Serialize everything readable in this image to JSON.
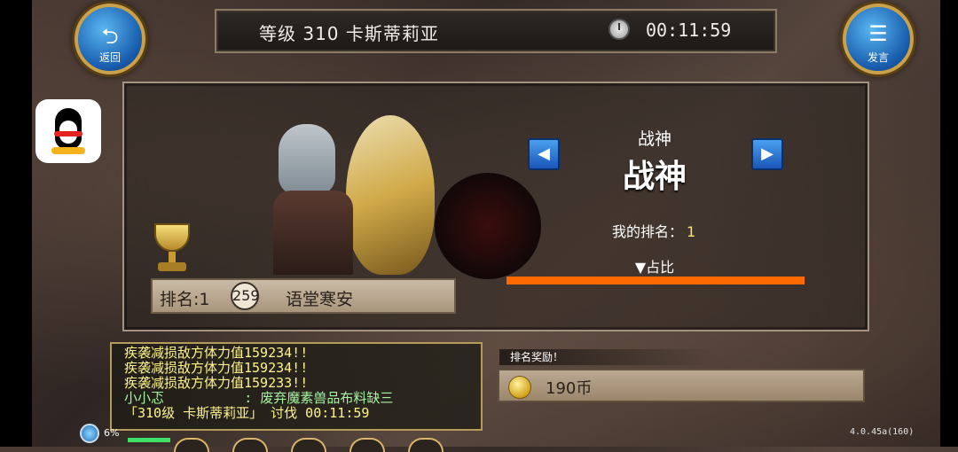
{
  "header": {
    "title": "等级 310 卡斯蒂莉亚",
    "timer": "00:11:59"
  },
  "buttons": {
    "back_label": "返回",
    "chat_label": "发言"
  },
  "panel": {
    "category_small": "战神",
    "category_big": "战神",
    "my_rank_label": "我的排名：",
    "my_rank_value": "1",
    "share_label": "▼占比",
    "player_rank": "排名:1",
    "player_level": "259",
    "player_name": "语堂寒安"
  },
  "chat": {
    "lines": [
      "疾袭减损敌方体力值159234!!",
      "疾袭减损敌方体力值159234!!",
      "疾袭减损敌方体力值159233!!",
      "小小忑          : 废弃魔素兽品布料缺三",
      "「310级 卡斯蒂莉亚」 讨伐 00:11:59"
    ]
  },
  "reward": {
    "label": "排名奖励！",
    "amount": "190币"
  },
  "footer": {
    "exp_percent": "6%",
    "version": "4.0.45a(160)"
  },
  "colors": {
    "accent_orange": "#ff6a00",
    "chat_yellow": "#fff58a",
    "chat_green": "#a6f3a0"
  },
  "icons": [
    "back-icon",
    "chat-icon",
    "qq-icon",
    "trophy-icon",
    "stopwatch-icon",
    "coin-icon",
    "left-arrow-icon",
    "right-arrow-icon"
  ]
}
